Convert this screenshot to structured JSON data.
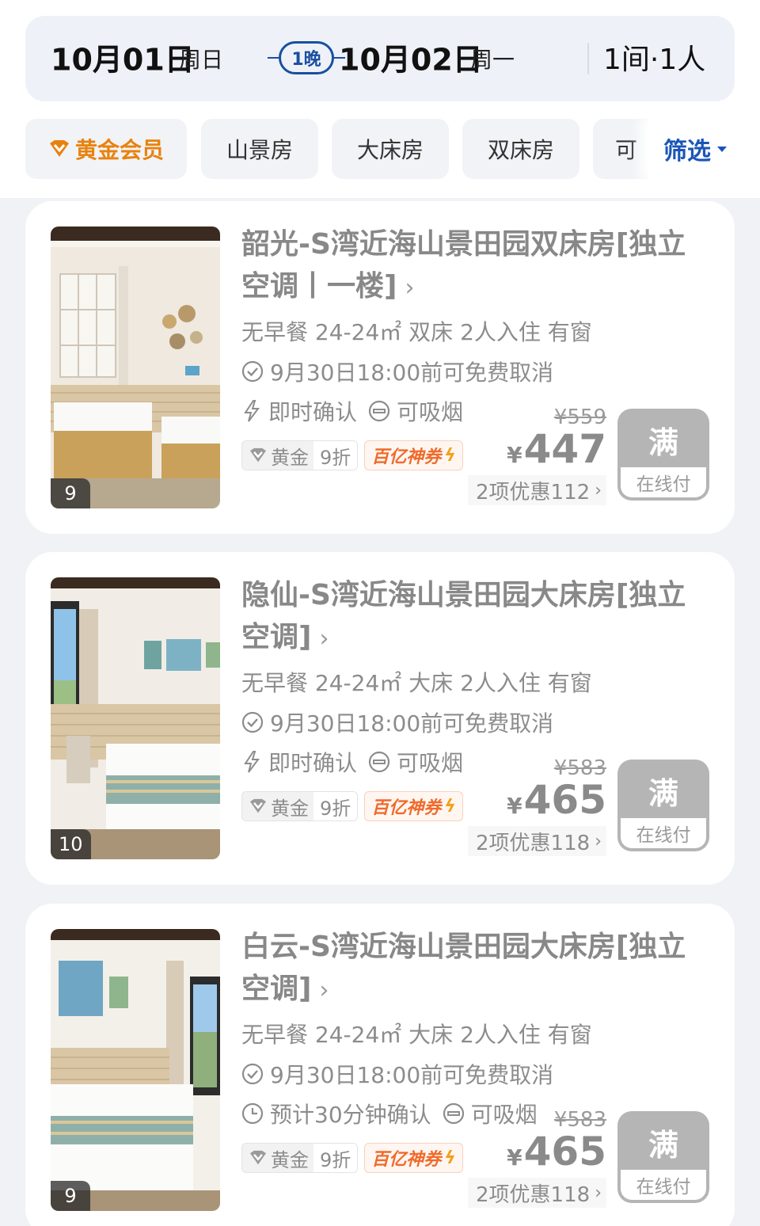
{
  "stay": {
    "checkin_date": "10月01日",
    "checkin_weekday": "周日",
    "nights": "1晚",
    "checkout_date": "10月02日",
    "checkout_weekday": "周一",
    "rooms_guests": "1间·1人"
  },
  "filters": {
    "chips": [
      "黄金会员",
      "山景房",
      "大床房",
      "双床房",
      "可"
    ],
    "filter_label": "筛选"
  },
  "colors": {
    "accent_blue": "#1a56b8",
    "gold": "#e8820e",
    "coupon": "#ef6b2c",
    "sold_out": "#b5b5b5"
  },
  "rooms": [
    {
      "title": "韶光-S湾近海山景田园双床房[独立空调丨一楼]",
      "photo_count": "9",
      "specs": "无早餐 24-24㎡ 双床 2人入住 有窗",
      "cancel": "9月30日18:00前可免费取消",
      "confirm": "即时确认",
      "confirm_icon": "lightning-icon",
      "smoking": "可吸烟",
      "badge_member": "黄金",
      "badge_discount": "9折",
      "badge_coupon": "百亿神券",
      "original_price": "¥559",
      "currency": "¥",
      "price": "447",
      "discount_info": "2项优惠112",
      "status": "满",
      "pay": "在线付"
    },
    {
      "title": "隐仙-S湾近海山景田园大床房[独立空调]",
      "photo_count": "10",
      "specs": "无早餐 24-24㎡ 大床 2人入住 有窗",
      "cancel": "9月30日18:00前可免费取消",
      "confirm": "即时确认",
      "confirm_icon": "lightning-icon",
      "smoking": "可吸烟",
      "badge_member": "黄金",
      "badge_discount": "9折",
      "badge_coupon": "百亿神券",
      "original_price": "¥583",
      "currency": "¥",
      "price": "465",
      "discount_info": "2项优惠118",
      "status": "满",
      "pay": "在线付"
    },
    {
      "title": "白云-S湾近海山景田园大床房[独立空调]",
      "photo_count": "9",
      "specs": "无早餐 24-24㎡ 大床 2人入住 有窗",
      "cancel": "9月30日18:00前可免费取消",
      "confirm": "预计30分钟确认",
      "confirm_icon": "clock-icon",
      "smoking": "可吸烟",
      "badge_member": "黄金",
      "badge_discount": "9折",
      "badge_coupon": "百亿神券",
      "original_price": "¥583",
      "currency": "¥",
      "price": "465",
      "discount_info": "2项优惠118",
      "status": "满",
      "pay": "在线付"
    }
  ]
}
